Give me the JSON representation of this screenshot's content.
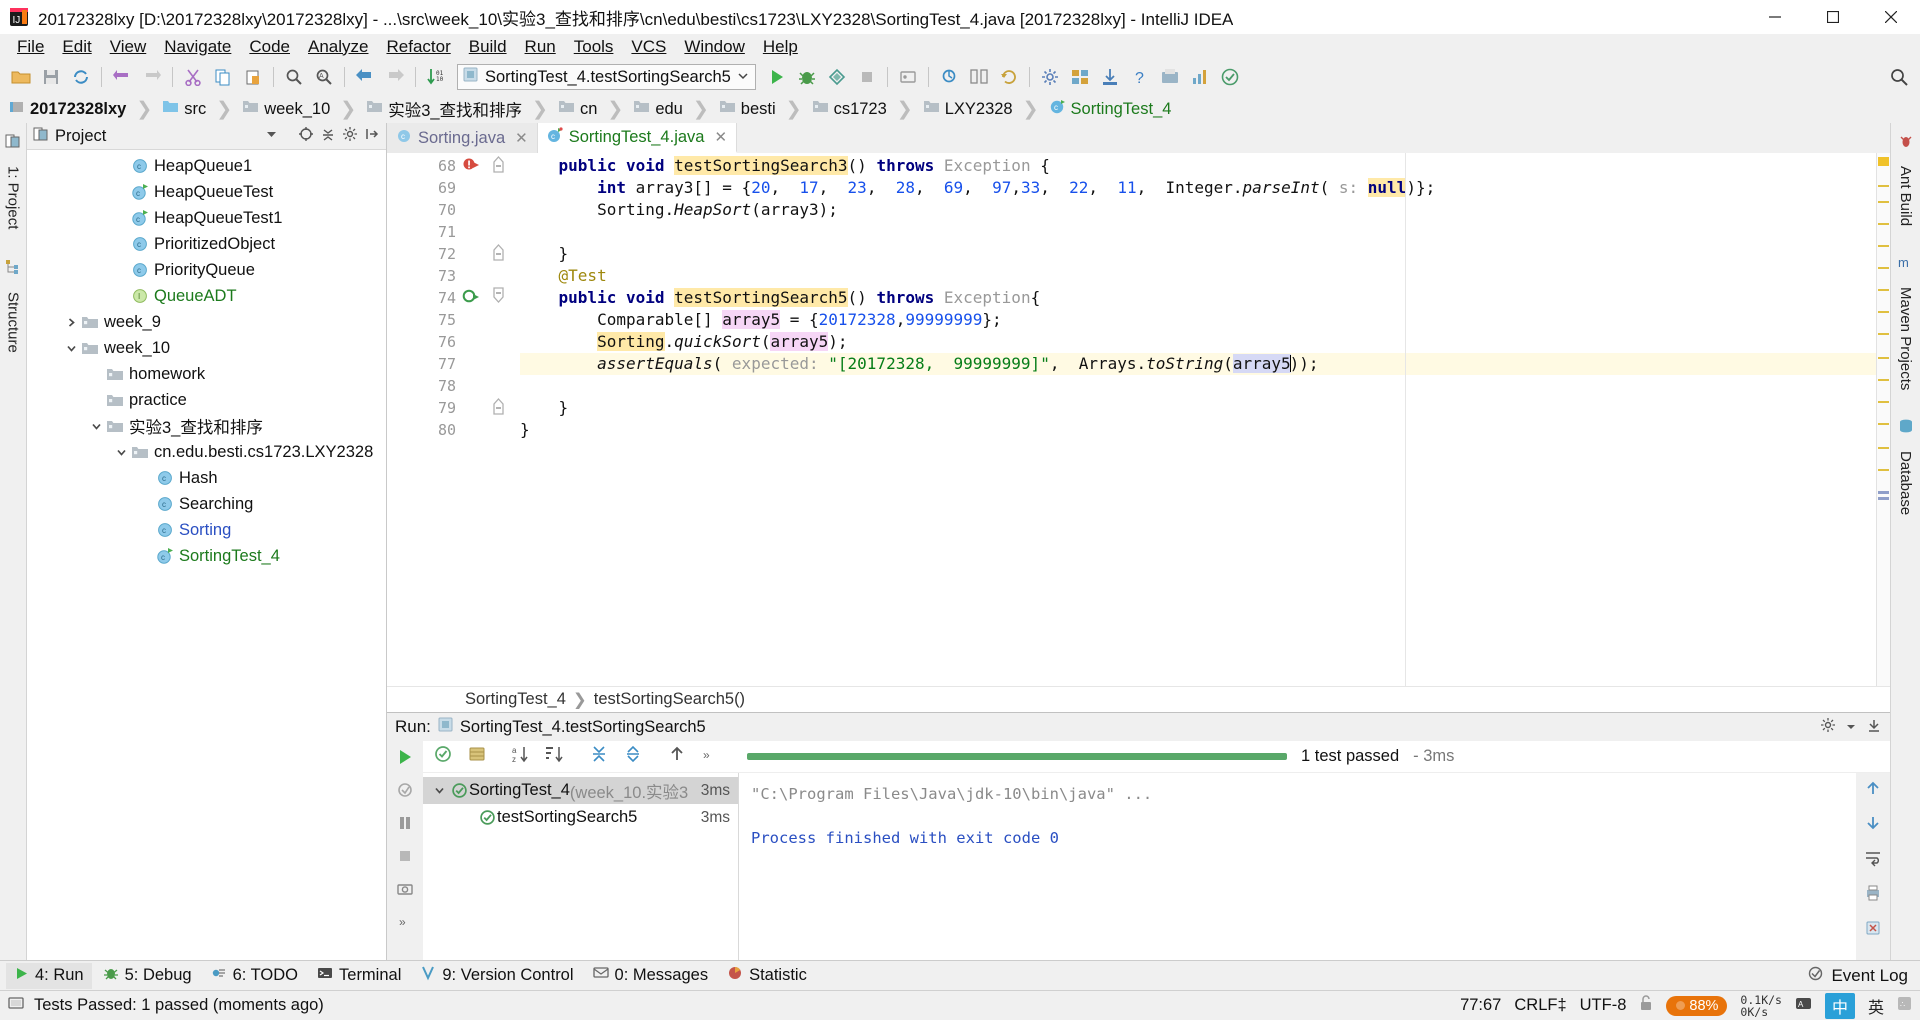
{
  "window": {
    "title": "20172328lxy [D:\\20172328lxy\\20172328lxy] - ...\\src\\week_10\\实验3_查找和排序\\cn\\edu\\besti\\cs1723\\LXY2328\\SortingTest_4.java [20172328lxy] - IntelliJ IDEA",
    "minimize": "minimize-button",
    "maximize": "maximize-button",
    "close": "close-button"
  },
  "menubar": [
    {
      "label": "File"
    },
    {
      "label": "Edit"
    },
    {
      "label": "View"
    },
    {
      "label": "Navigate"
    },
    {
      "label": "Code"
    },
    {
      "label": "Analyze"
    },
    {
      "label": "Refactor"
    },
    {
      "label": "Build"
    },
    {
      "label": "Run"
    },
    {
      "label": "Tools"
    },
    {
      "label": "VCS"
    },
    {
      "label": "Window"
    },
    {
      "label": "Help"
    }
  ],
  "toolbar": {
    "run_config": "SortingTest_4.testSortingSearch5",
    "icons": [
      "open-folder-icon",
      "save-all-icon",
      "sync-icon",
      "undo-icon",
      "redo-icon",
      "cut-icon",
      "copy-icon",
      "paste-icon",
      "find-icon",
      "replace-icon",
      "back-icon",
      "forward-icon",
      "sort-icon"
    ],
    "right_icons": [
      "run-icon",
      "debug-icon",
      "run-coverage-icon",
      "stop-icon",
      "build-icon",
      "attach-icon",
      "search-everywhere-icon",
      "settings-icon",
      "project-structure-icon",
      "sdk-icon",
      "help-icon",
      "update-icon",
      "chart-icon",
      "check-icon",
      "magnifier-icon"
    ]
  },
  "breadcrumbs": [
    {
      "label": "20172328lxy",
      "icon": "module-icon",
      "kind": "module"
    },
    {
      "label": "src",
      "icon": "source-folder-icon",
      "kind": "source"
    },
    {
      "label": "week_10",
      "icon": "folder-icon",
      "kind": "folder"
    },
    {
      "label": "实验3_查找和排序",
      "icon": "folder-icon",
      "kind": "folder"
    },
    {
      "label": "cn",
      "icon": "folder-icon",
      "kind": "folder"
    },
    {
      "label": "edu",
      "icon": "folder-icon",
      "kind": "folder"
    },
    {
      "label": "besti",
      "icon": "folder-icon",
      "kind": "folder"
    },
    {
      "label": "cs1723",
      "icon": "folder-icon",
      "kind": "folder"
    },
    {
      "label": "LXY2328",
      "icon": "folder-icon",
      "kind": "folder"
    },
    {
      "label": "SortingTest_4",
      "icon": "java-class-icon",
      "kind": "class"
    }
  ],
  "left_rail": [
    "1: Project",
    "Structure"
  ],
  "right_rail": [
    "Ant Build",
    "Maven Projects",
    "Database"
  ],
  "project_panel": {
    "title": "Project",
    "header_icons": [
      "locate-icon",
      "collapse-all-icon",
      "settings-gear-icon",
      "hide-icon"
    ],
    "tree": [
      {
        "label": "HeapQueue1",
        "icon": "java-class-icon",
        "indent": 3,
        "arrow": "",
        "style": ""
      },
      {
        "label": "HeapQueueTest",
        "icon": "java-test-class-icon",
        "indent": 3,
        "arrow": "",
        "style": ""
      },
      {
        "label": "HeapQueueTest1",
        "icon": "java-test-class-icon",
        "indent": 3,
        "arrow": "",
        "style": ""
      },
      {
        "label": "PrioritizedObject",
        "icon": "java-class-icon",
        "indent": 3,
        "arrow": "",
        "style": ""
      },
      {
        "label": "PriorityQueue",
        "icon": "java-class-icon",
        "indent": 3,
        "arrow": "",
        "style": ""
      },
      {
        "label": "QueueADT",
        "icon": "java-interface-icon",
        "indent": 3,
        "arrow": "",
        "style": "green"
      },
      {
        "label": "week_9",
        "icon": "folder-icon",
        "indent": 1,
        "arrow": "collapsed",
        "style": ""
      },
      {
        "label": "week_10",
        "icon": "folder-icon",
        "indent": 1,
        "arrow": "expanded",
        "style": ""
      },
      {
        "label": "homework",
        "icon": "folder-icon",
        "indent": 2,
        "arrow": "",
        "style": ""
      },
      {
        "label": "practice",
        "icon": "folder-icon",
        "indent": 2,
        "arrow": "",
        "style": ""
      },
      {
        "label": "实验3_查找和排序",
        "icon": "folder-icon",
        "indent": 2,
        "arrow": "expanded",
        "style": ""
      },
      {
        "label": "cn.edu.besti.cs1723.LXY2328",
        "icon": "folder-icon",
        "indent": 3,
        "arrow": "expanded",
        "style": ""
      },
      {
        "label": "Hash",
        "icon": "java-class-icon",
        "indent": 4,
        "arrow": "",
        "style": ""
      },
      {
        "label": "Searching",
        "icon": "java-class-icon",
        "indent": 4,
        "arrow": "",
        "style": ""
      },
      {
        "label": "Sorting",
        "icon": "java-class-icon",
        "indent": 4,
        "arrow": "",
        "style": "blue"
      },
      {
        "label": "SortingTest_4",
        "icon": "java-test-class-icon",
        "indent": 4,
        "arrow": "",
        "style": "green"
      }
    ]
  },
  "editor": {
    "tabs": [
      {
        "label": "Sorting.java",
        "icon": "java-class-icon",
        "active": false
      },
      {
        "label": "SortingTest_4.java",
        "icon": "java-test-class-icon",
        "active": true
      }
    ],
    "first_line_number": 68,
    "lines": [
      {
        "n": 68,
        "gutter": "error-run-icon",
        "fold": "fold-end",
        "highlight": false,
        "tokens": [
          {
            "t": "    ",
            "c": ""
          },
          {
            "t": "public",
            "c": "kw"
          },
          {
            "t": " ",
            "c": ""
          },
          {
            "t": "void",
            "c": "kw"
          },
          {
            "t": " ",
            "c": ""
          },
          {
            "t": "testSortingSearch3",
            "c": "hlname"
          },
          {
            "t": "() ",
            "c": ""
          },
          {
            "t": "throws",
            "c": "kw"
          },
          {
            "t": " ",
            "c": ""
          },
          {
            "t": "Exception",
            "c": "greytxt"
          },
          {
            "t": " {",
            "c": ""
          }
        ]
      },
      {
        "n": 69,
        "gutter": "",
        "fold": "",
        "highlight": false,
        "tokens": [
          {
            "t": "        ",
            "c": ""
          },
          {
            "t": "int",
            "c": "kw"
          },
          {
            "t": " array3[] = {",
            "c": ""
          },
          {
            "t": "20",
            "c": "num"
          },
          {
            "t": ",  ",
            "c": ""
          },
          {
            "t": "17",
            "c": "num"
          },
          {
            "t": ",  ",
            "c": ""
          },
          {
            "t": "23",
            "c": "num"
          },
          {
            "t": ",  ",
            "c": ""
          },
          {
            "t": "28",
            "c": "num"
          },
          {
            "t": ",  ",
            "c": ""
          },
          {
            "t": "69",
            "c": "num"
          },
          {
            "t": ",  ",
            "c": ""
          },
          {
            "t": "97",
            "c": "num"
          },
          {
            "t": ",",
            "c": ""
          },
          {
            "t": "33",
            "c": "num"
          },
          {
            "t": ",  ",
            "c": ""
          },
          {
            "t": "22",
            "c": "num"
          },
          {
            "t": ",  ",
            "c": ""
          },
          {
            "t": "11",
            "c": "num"
          },
          {
            "t": ",  Integer.",
            "c": ""
          },
          {
            "t": "parseInt",
            "c": "ital"
          },
          {
            "t": "( ",
            "c": ""
          },
          {
            "t": "s:",
            "c": "hintp"
          },
          {
            "t": " ",
            "c": ""
          },
          {
            "t": "null",
            "c": "kw hlname"
          },
          {
            "t": ")};",
            "c": ""
          }
        ]
      },
      {
        "n": 70,
        "gutter": "",
        "fold": "",
        "highlight": false,
        "tokens": [
          {
            "t": "        Sorting.",
            "c": ""
          },
          {
            "t": "HeapSort",
            "c": "ital"
          },
          {
            "t": "(array3);",
            "c": ""
          }
        ]
      },
      {
        "n": 71,
        "gutter": "",
        "fold": "",
        "highlight": false,
        "tokens": [
          {
            "t": "",
            "c": ""
          }
        ]
      },
      {
        "n": 72,
        "gutter": "",
        "fold": "fold-end",
        "highlight": false,
        "tokens": [
          {
            "t": "    }",
            "c": ""
          }
        ]
      },
      {
        "n": 73,
        "gutter": "",
        "fold": "",
        "highlight": false,
        "tokens": [
          {
            "t": "    ",
            "c": ""
          },
          {
            "t": "@Test",
            "c": "ann"
          }
        ]
      },
      {
        "n": 74,
        "gutter": "run-test-icon",
        "fold": "fold-start",
        "highlight": false,
        "tokens": [
          {
            "t": "    ",
            "c": ""
          },
          {
            "t": "public",
            "c": "kw"
          },
          {
            "t": " ",
            "c": ""
          },
          {
            "t": "void",
            "c": "kw"
          },
          {
            "t": " ",
            "c": ""
          },
          {
            "t": "testSortingSearch5",
            "c": "hlname"
          },
          {
            "t": "() ",
            "c": ""
          },
          {
            "t": "throws",
            "c": "kw"
          },
          {
            "t": " ",
            "c": ""
          },
          {
            "t": "Exception",
            "c": "greytxt"
          },
          {
            "t": "{",
            "c": ""
          }
        ]
      },
      {
        "n": 75,
        "gutter": "",
        "fold": "",
        "highlight": false,
        "tokens": [
          {
            "t": "        Comparable[] ",
            "c": ""
          },
          {
            "t": "array5",
            "c": "hlvar"
          },
          {
            "t": " = {",
            "c": ""
          },
          {
            "t": "20172328",
            "c": "num"
          },
          {
            "t": ",",
            "c": ""
          },
          {
            "t": "99999999",
            "c": "num"
          },
          {
            "t": "};",
            "c": ""
          }
        ]
      },
      {
        "n": 76,
        "gutter": "",
        "fold": "",
        "highlight": false,
        "tokens": [
          {
            "t": "        ",
            "c": ""
          },
          {
            "t": "Sorting",
            "c": "hlname"
          },
          {
            "t": ".",
            "c": ""
          },
          {
            "t": "quickSort",
            "c": "ital"
          },
          {
            "t": "(",
            "c": ""
          },
          {
            "t": "array5",
            "c": "hlvar"
          },
          {
            "t": ");",
            "c": ""
          }
        ]
      },
      {
        "n": 77,
        "gutter": "",
        "fold": "",
        "highlight": true,
        "tokens": [
          {
            "t": "        ",
            "c": ""
          },
          {
            "t": "assertEquals",
            "c": "ital"
          },
          {
            "t": "( ",
            "c": ""
          },
          {
            "t": "expected:",
            "c": "hintp"
          },
          {
            "t": " ",
            "c": ""
          },
          {
            "t": "\"[20172328,  99999999]\"",
            "c": "str"
          },
          {
            "t": ",  Arrays.",
            "c": ""
          },
          {
            "t": "toString",
            "c": "ital"
          },
          {
            "t": "(",
            "c": ""
          },
          {
            "t": "array5",
            "c": "hlsel"
          },
          {
            "t": "));",
            "c": ""
          }
        ]
      },
      {
        "n": 78,
        "gutter": "",
        "fold": "",
        "highlight": false,
        "tokens": [
          {
            "t": "",
            "c": ""
          }
        ]
      },
      {
        "n": 79,
        "gutter": "",
        "fold": "fold-end",
        "highlight": false,
        "tokens": [
          {
            "t": "    }",
            "c": ""
          }
        ]
      },
      {
        "n": 80,
        "gutter": "",
        "fold": "",
        "highlight": false,
        "tokens": [
          {
            "t": "}",
            "c": ""
          }
        ]
      }
    ],
    "status_breadcrumb": [
      "SortingTest_4",
      "testSortingSearch5()"
    ]
  },
  "run_panel": {
    "header_title": "Run:",
    "header_config": "SortingTest_4.testSortingSearch5",
    "header_icons": [
      "settings-gear-icon",
      "hide-panel-icon"
    ],
    "left_icons": [
      "rerun-icon",
      "rerun-failed-icon",
      "pause-icon",
      "dump-threads-icon",
      "camera-icon",
      "more-icon"
    ],
    "toolbar_icons": [
      "show-passed-icon",
      "show-ignored-icon",
      "sort-alpha-icon",
      "sort-duration-icon",
      "expand-all-icon",
      "collapse-all-icon",
      "prev-icon",
      "more-options-icon"
    ],
    "summary_text": "1 test passed",
    "summary_time": "- 3ms",
    "tests": [
      {
        "name": "SortingTest_4",
        "suffix": "(week_10.实验3",
        "time": "3ms",
        "selected": true,
        "indent": 0,
        "arrow": "expanded",
        "status": "passed"
      },
      {
        "name": "testSortingSearch5",
        "suffix": "",
        "time": "3ms",
        "selected": false,
        "indent": 1,
        "arrow": "",
        "status": "passed"
      }
    ],
    "console": [
      {
        "text": "\"C:\\Program Files\\Java\\jdk-10\\bin\\java\" ...",
        "style": "grey"
      },
      {
        "text": "",
        "style": ""
      },
      {
        "text": "Process finished with exit code 0",
        "style": "blue"
      }
    ],
    "console_rail_icons": [
      "scroll-up-icon",
      "scroll-down-icon",
      "soft-wrap-icon",
      "print-icon",
      "clear-icon"
    ]
  },
  "tool_window_bar": {
    "items": [
      {
        "label": "4: Run",
        "icon": "run-icon",
        "active": true
      },
      {
        "label": "5: Debug",
        "icon": "debug-icon",
        "active": false
      },
      {
        "label": "6: TODO",
        "icon": "todo-icon",
        "active": false
      },
      {
        "label": "Terminal",
        "icon": "terminal-icon",
        "active": false
      },
      {
        "label": "9: Version Control",
        "icon": "version-control-icon",
        "active": false
      },
      {
        "label": "0: Messages",
        "icon": "messages-icon",
        "active": false
      },
      {
        "label": "Statistic",
        "icon": "statistic-icon",
        "active": false
      }
    ],
    "right": [
      {
        "label": "Event Log",
        "icon": "event-log-icon"
      }
    ]
  },
  "status_bar": {
    "message": "Tests Passed: 1 passed (moments ago)",
    "caret_position": "77:67",
    "line_separator": "CRLF",
    "encoding": "UTF-8",
    "memory": "88%",
    "net_up": "0.1K/s",
    "net_down": "0K/s",
    "ime_label": "中",
    "ime_label2": "英",
    "lock_icon": "unlocked-icon"
  },
  "colors": {
    "accent_green": "#59a869",
    "selection": "#d4d4d4",
    "highlight_line": "#fffae3",
    "memory_badge": "#e8730a"
  }
}
